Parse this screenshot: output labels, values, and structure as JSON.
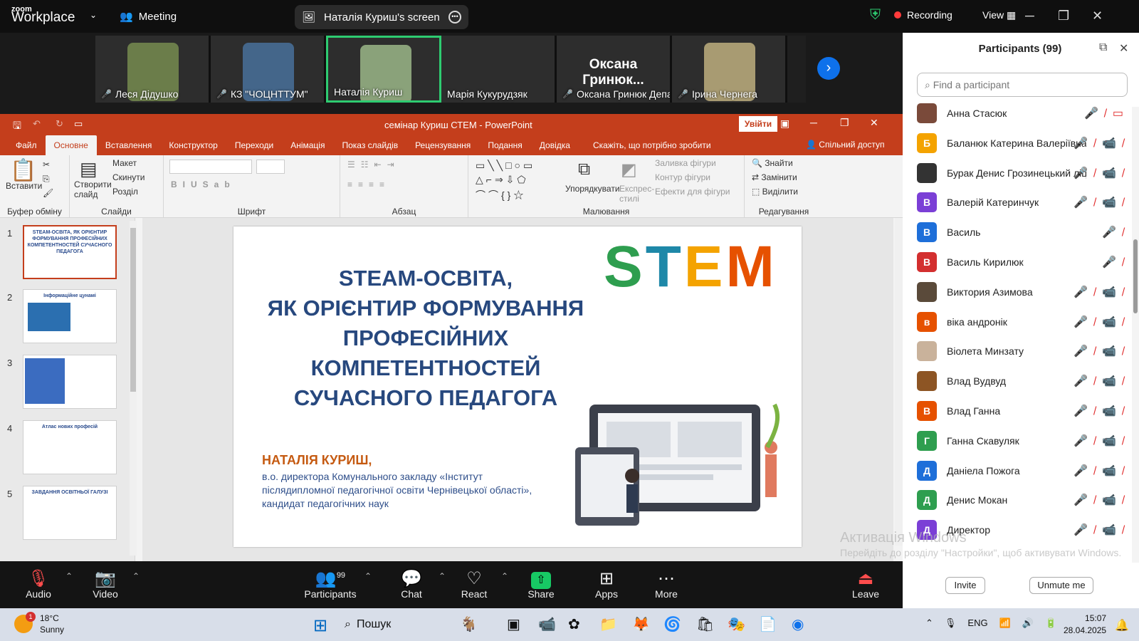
{
  "zoom": {
    "logo_top": "zoom",
    "logo_bottom": "Workplace",
    "meeting_label": "Meeting",
    "share_pill": "Наталія Куриш's screen",
    "recording": "Recording",
    "view": "View"
  },
  "videos": [
    {
      "name": "Леся Дідушко",
      "color": "#6b7d4a"
    },
    {
      "name": "КЗ \"ЧОЦНТТУМ\"",
      "color": "#44668a"
    },
    {
      "name": "Наталія Куриш",
      "color": "#8aa27a"
    },
    {
      "name": "Марія Кукурудзяк",
      "color": "#1f1f1f"
    },
    {
      "name": "Оксана Гринюк Депа...",
      "color": "#1f1f1f",
      "big": "Оксана Гринюк..."
    },
    {
      "name": "Ірина Чернега",
      "color": "#a89b72"
    }
  ],
  "ppt": {
    "title": "семінар Куриш СТЕМ  -  PowerPoint",
    "signin": "Увійти",
    "share": "Спільний доступ",
    "tabs": [
      "Файл",
      "Основне",
      "Вставлення",
      "Конструктор",
      "Переходи",
      "Анімація",
      "Показ слайдів",
      "Рецензування",
      "Подання",
      "Довідка",
      "Скажіть, що потрібно зробити"
    ],
    "ribbon": {
      "paste": "Вставити",
      "clipboard": "Буфер обміну",
      "new_slide": "Створити слайд",
      "layout": "Макет",
      "reset": "Скинути",
      "section": "Розділ",
      "slides": "Слайди",
      "font": "Шрифт",
      "paragraph": "Абзац",
      "arrange": "Упорядкувати",
      "quick_styles": "Експрес-стилі",
      "shape_fill": "Заливка фігури",
      "shape_outline": "Контур фігури",
      "shape_effects": "Ефекти для фігури",
      "drawing": "Малювання",
      "find": "Знайти",
      "replace": "Замінити",
      "select": "Виділити",
      "editing": "Редагування"
    },
    "thumbs": [
      {
        "n": "1",
        "text": "STEAM-ОСВІТА, ЯК ОРІЄНТИР ФОРМУВАННЯ ПРОФЕСІЙНИХ КОМПЕТЕНТНОСТЕЙ СУЧАСНОГО ПЕДАГОГА"
      },
      {
        "n": "2",
        "text": "Інформаційне цунамі"
      },
      {
        "n": "3",
        "text": ""
      },
      {
        "n": "4",
        "text": "Атлас нових професій"
      },
      {
        "n": "5",
        "text": "ЗАВДАННЯ ОСВІТНЬОЇ ГАЛУЗІ"
      }
    ],
    "slide": {
      "title_lines": [
        "STEAM-ОСВІТА,",
        "ЯК ОРІЄНТИР ФОРМУВАННЯ",
        "ПРОФЕСІЙНИХ КОМПЕТЕНТНОСТЕЙ",
        "СУЧАСНОГО ПЕДАГОГА"
      ],
      "author": "НАТАЛІЯ КУРИШ,",
      "affiliation": "в.о. директора Комунального закладу «Інститут післядипломної педагогічної освіти Чернівецької області», кандидат педагогічних наук",
      "stem_letters": [
        "S",
        "T",
        "E",
        "M"
      ]
    }
  },
  "participants": {
    "title": "Participants (99)",
    "search_placeholder": "Find a participant",
    "list": [
      {
        "name": "Анна Стасюк",
        "initial": "",
        "color": "#7a4a3a"
      },
      {
        "name": "Баланюк Катерина Валеріївна",
        "initial": "Б",
        "color": "#f4a300"
      },
      {
        "name": "Бурак Денис Грозинецький ліц...",
        "initial": "",
        "color": "#333333"
      },
      {
        "name": "Валерій Катеринчук",
        "initial": "В",
        "color": "#7b3fd6"
      },
      {
        "name": "Василь",
        "initial": "В",
        "color": "#1e6fd9"
      },
      {
        "name": "Василь Кирилюк",
        "initial": "В",
        "color": "#d32f2f"
      },
      {
        "name": "Виктория Азимова",
        "initial": "",
        "color": "#5a4a3a"
      },
      {
        "name": "віка андронік",
        "initial": "в",
        "color": "#e65100"
      },
      {
        "name": "Віолета Минзату",
        "initial": "",
        "color": "#c9b29b"
      },
      {
        "name": "Влад Вудвуд",
        "initial": "",
        "color": "#8d5524"
      },
      {
        "name": "Влад Ганна",
        "initial": "В",
        "color": "#e65100"
      },
      {
        "name": "Ганна Скавуляк",
        "initial": "Г",
        "color": "#2e9e4f"
      },
      {
        "name": "Даніела Пожога",
        "initial": "Д",
        "color": "#1e6fd9"
      },
      {
        "name": "Денис Мокан",
        "initial": "Д",
        "color": "#2e9e4f"
      },
      {
        "name": "Директор",
        "initial": "Д",
        "color": "#7b3fd6"
      }
    ],
    "invite": "Invite",
    "unmute_me": "Unmute me"
  },
  "toolbar": {
    "audio": "Audio",
    "video": "Video",
    "participants": "Participants",
    "participants_count": "99",
    "chat": "Chat",
    "react": "React",
    "share": "Share",
    "apps": "Apps",
    "more": "More",
    "leave": "Leave"
  },
  "watermark": {
    "line1": "Активація Windows",
    "line2": "Перейдіть до розділу \"Настройки\", щоб активувати Windows."
  },
  "taskbar": {
    "temp": "18°C",
    "weather": "Sunny",
    "weather_badge": "1",
    "search": "Пошук",
    "lang": "ENG",
    "time": "15:07",
    "date": "28.04.2025"
  }
}
